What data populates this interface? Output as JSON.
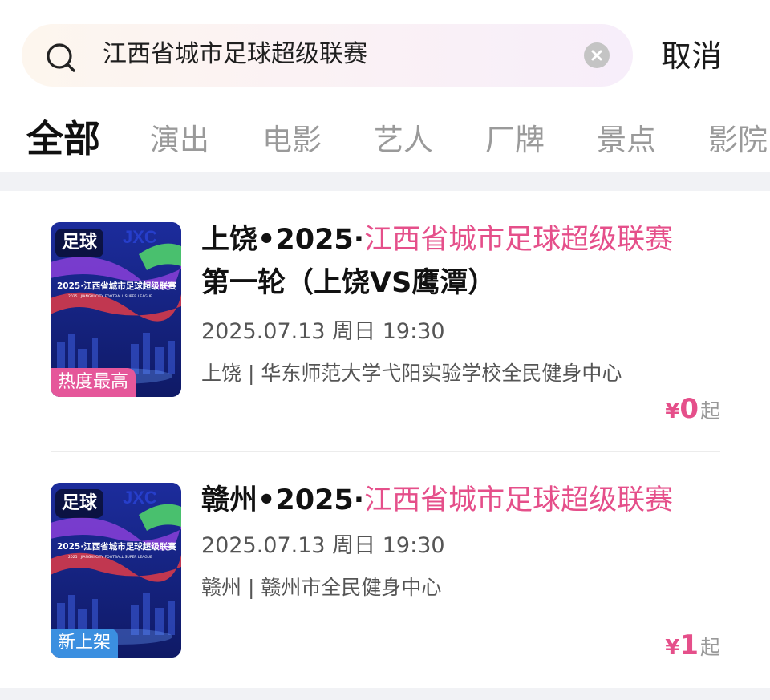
{
  "search": {
    "query": "江西省城市足球超级联赛",
    "cancel_label": "取消"
  },
  "tabs": [
    {
      "label": "全部",
      "active": true
    },
    {
      "label": "演出",
      "active": false
    },
    {
      "label": "电影",
      "active": false
    },
    {
      "label": "艺人",
      "active": false
    },
    {
      "label": "厂牌",
      "active": false
    },
    {
      "label": "景点",
      "active": false
    },
    {
      "label": "影院",
      "active": false
    }
  ],
  "results": [
    {
      "category": "足球",
      "badge": "热度最高",
      "badge_color": "#e5579a",
      "title_prefix": "上饶•2025·",
      "title_highlight": "江西省城市足球超级联赛",
      "title_suffix": "第一轮（上饶VS鹰潭）",
      "datetime": "2025.07.13 周日 19:30",
      "venue": "上饶 | 华东师范大学弋阳实验学校全民健身中心",
      "price_currency": "¥",
      "price_value": "0",
      "price_suffix": "起"
    },
    {
      "category": "足球",
      "badge": "新上架",
      "badge_color": "#3b8fe0",
      "title_prefix": "赣州•2025·",
      "title_highlight": "江西省城市足球超级联赛",
      "title_suffix": "",
      "datetime": "2025.07.13 周日 19:30",
      "venue": "赣州 | 赣州市全民健身中心",
      "price_currency": "¥",
      "price_value": "1",
      "price_suffix": "起"
    }
  ],
  "poster_art": {
    "logo_text": "JXC",
    "headline": "2025·江西省城市足球超级联赛",
    "sub": "2025 · JIANGXI CITY FOOTBALL SUPER LEAGUE"
  },
  "colors": {
    "accent": "#e54f8a",
    "tab_inactive": "#9a9a9a"
  }
}
